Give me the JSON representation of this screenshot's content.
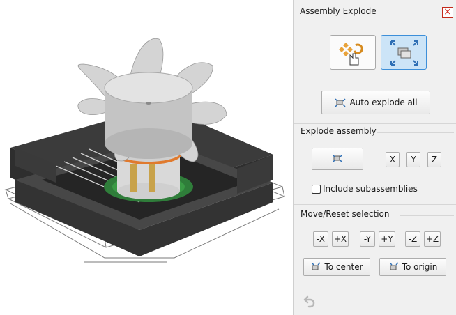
{
  "panel": {
    "title": "Assembly Explode",
    "auto_explode_label": "Auto explode all",
    "explode_group_label": "Explode assembly",
    "axis_buttons": [
      "X",
      "Y",
      "Z"
    ],
    "include_subassemblies_label": "Include subassemblies",
    "include_subassemblies_checked": false,
    "move_group_label": "Move/Reset selection",
    "move_buttons": [
      "-X",
      "+X",
      "-Y",
      "+Y",
      "-Z",
      "+Z"
    ],
    "to_center_label": "To center",
    "to_origin_label": "To origin"
  },
  "icons": {
    "close": "close-icon",
    "select_mode": "select-pointer-icon",
    "explode_mode": "explode-arrows-icon",
    "undo": "undo-icon"
  },
  "colors": {
    "active_mode": "#cce4f7",
    "active_border": "#3d8fd9",
    "close_red": "#d0261b"
  }
}
